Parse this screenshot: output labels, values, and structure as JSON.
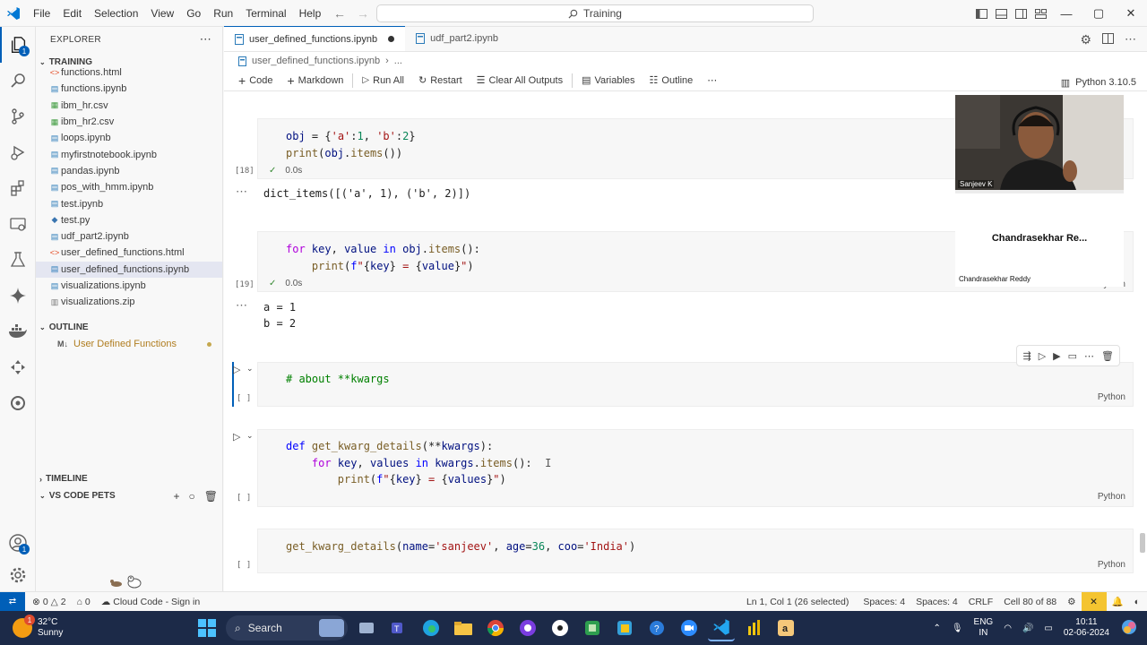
{
  "menu": [
    "File",
    "Edit",
    "Selection",
    "View",
    "Go",
    "Run",
    "Terminal",
    "Help"
  ],
  "search": {
    "label": "Training"
  },
  "sidebar": {
    "header": "EXPLORER",
    "folder": "TRAINING",
    "files": [
      {
        "name": "functions.html",
        "icon": "html"
      },
      {
        "name": "functions.ipynb",
        "icon": "notebook"
      },
      {
        "name": "ibm_hr.csv",
        "icon": "csv"
      },
      {
        "name": "ibm_hr2.csv",
        "icon": "csv"
      },
      {
        "name": "loops.ipynb",
        "icon": "notebook"
      },
      {
        "name": "myfirstnotebook.ipynb",
        "icon": "notebook"
      },
      {
        "name": "pandas.ipynb",
        "icon": "notebook"
      },
      {
        "name": "pos_with_hmm.ipynb",
        "icon": "notebook"
      },
      {
        "name": "test.ipynb",
        "icon": "notebook"
      },
      {
        "name": "test.py",
        "icon": "python"
      },
      {
        "name": "udf_part2.ipynb",
        "icon": "notebook"
      },
      {
        "name": "user_defined_functions.html",
        "icon": "html"
      },
      {
        "name": "user_defined_functions.ipynb",
        "icon": "notebook"
      },
      {
        "name": "visualizations.ipynb",
        "icon": "notebook"
      },
      {
        "name": "visualizations.zip",
        "icon": "zip"
      }
    ],
    "outline_header": "OUTLINE",
    "outline_prefix": "M↓",
    "outline_item": "User Defined Functions",
    "timeline": "TIMELINE",
    "pets": "VS CODE PETS"
  },
  "tabs": [
    {
      "label": "user_defined_functions.ipynb",
      "active": true
    },
    {
      "label": "udf_part2.ipynb",
      "active": false
    }
  ],
  "breadcrumb": {
    "file": "user_defined_functions.ipynb",
    "rest": "..."
  },
  "toolbar": {
    "code": "Code",
    "markdown": "Markdown",
    "run_all": "Run All",
    "restart": "Restart",
    "clear": "Clear All Outputs",
    "variables": "Variables",
    "outline": "Outline",
    "kernel": "Python 3.10.5"
  },
  "cells": {
    "c18": {
      "count": "[18]",
      "time": "0.0s",
      "output": "dict_items([('a', 1), ('b', 2)])",
      "lang": "Python"
    },
    "c19": {
      "count": "[19]",
      "time": "0.0s",
      "output_line1": "a = 1",
      "output_line2": "b = 2",
      "lang": "Python"
    },
    "c20": {
      "count": "[ ]",
      "lang": "Python"
    },
    "c21": {
      "count": "[ ]",
      "lang": "Python"
    },
    "c22": {
      "count": "[ ]",
      "lang": "Python"
    }
  },
  "video": {
    "presenter": "Sanjeev K",
    "participant_big": "Chandrasekhar  Re...",
    "participant_small": "Chandrasekhar Reddy"
  },
  "status": {
    "errors": "0",
    "warnings": "2",
    "ports": "0",
    "cloud": "Cloud Code - Sign in",
    "position": "Ln 1, Col 1 (26 selected)",
    "spaces1": "Spaces: 4",
    "spaces2": "Spaces: 4",
    "eol": "CRLF",
    "cell": "Cell 80 of 88"
  },
  "taskbar": {
    "temp": "32°C",
    "weather": "Sunny",
    "weather_badge": "1",
    "search": "Search",
    "lang1": "ENG",
    "lang2": "IN",
    "time": "10:11",
    "date": "02-06-2024"
  },
  "colors": {
    "accent": "#005fb8",
    "keyword": "#af00db",
    "function": "#795e26",
    "string": "#a31515",
    "number": "#098658",
    "comment": "#008000"
  }
}
